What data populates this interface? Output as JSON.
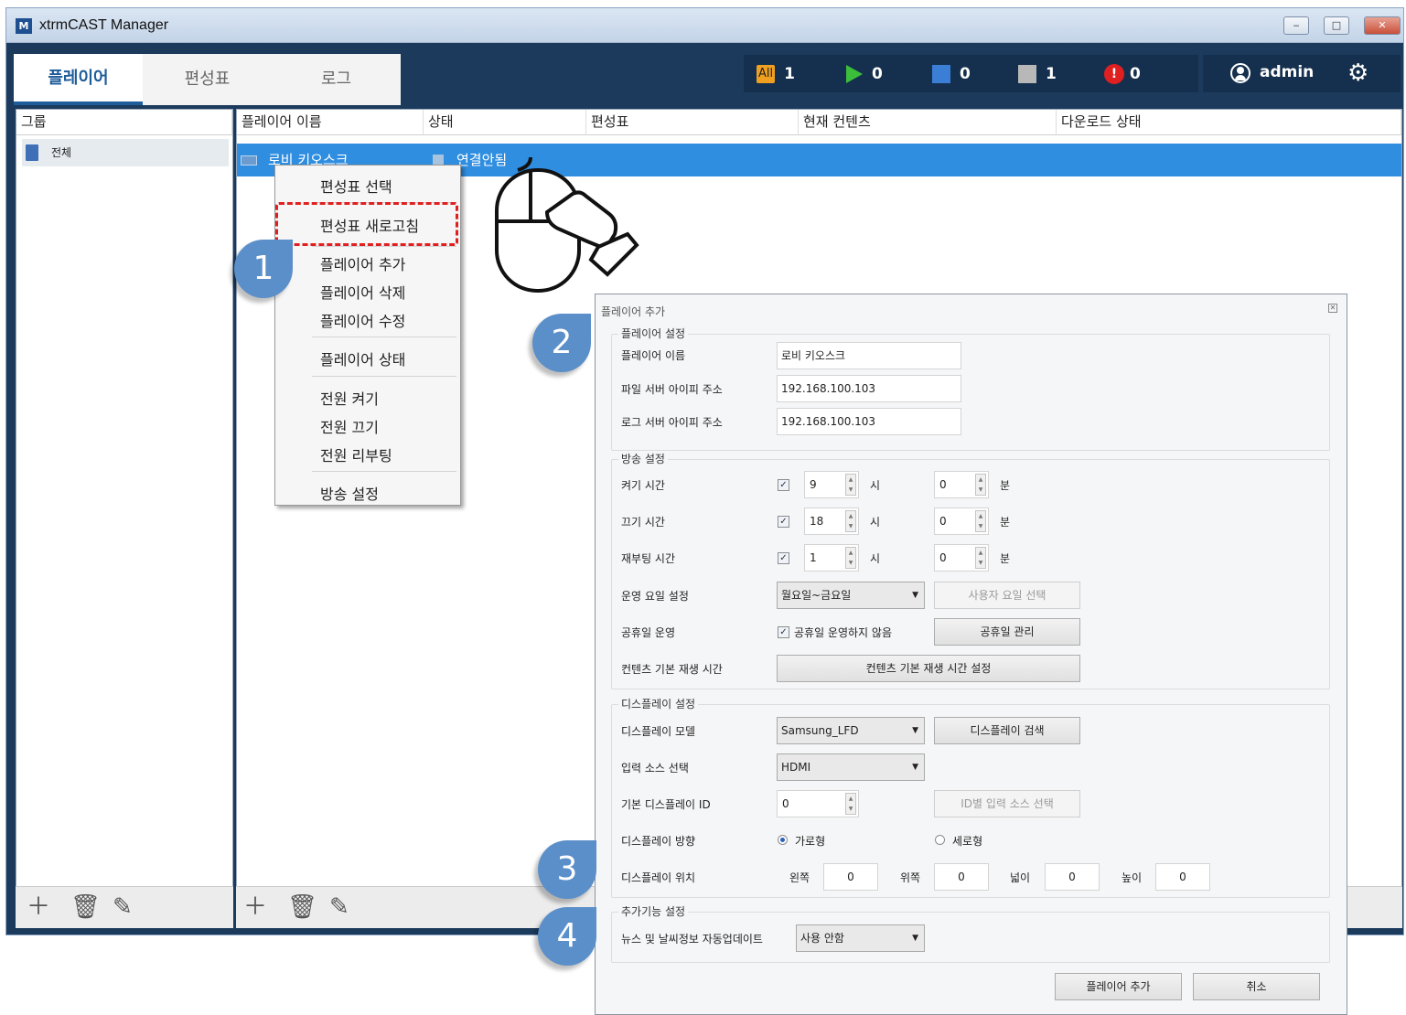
{
  "window": {
    "app_logo": "M",
    "title": "xtrmCAST Manager",
    "controls": {
      "minimize": "‒",
      "maximize": "□",
      "close": "✕"
    }
  },
  "tabs": [
    {
      "label": "플레이어",
      "active": true
    },
    {
      "label": "편성표",
      "active": false
    },
    {
      "label": "로그",
      "active": false
    }
  ],
  "status": {
    "all": {
      "icon_text": "All",
      "count": "1",
      "color": "#f0a020"
    },
    "playing": {
      "count": "0",
      "color": "#3bbf3b"
    },
    "stopped": {
      "count": "0",
      "color": "#3a7fd5"
    },
    "disconnected": {
      "count": "1",
      "color": "#b8b8b8"
    },
    "error": {
      "icon_text": "!",
      "count": "0",
      "color": "#e02020"
    }
  },
  "user": {
    "name": "admin",
    "icon": "user-icon",
    "settings_icon": "gear-icon"
  },
  "group_panel": {
    "header": "그룹",
    "items": [
      {
        "label": "전체",
        "icon": "document-icon"
      }
    ]
  },
  "player_table": {
    "columns": [
      "플레이어 이름",
      "상태",
      "편성표",
      "현재 컨텐츠",
      "다운로드 상태"
    ],
    "rows": [
      {
        "name": "로비 키오스크",
        "status": "연결안됨",
        "schedule": "",
        "content": "",
        "download": ""
      }
    ]
  },
  "context_menu": {
    "items": [
      "편성표 선택",
      "편성표 새로고침",
      "플레이어 추가",
      "플레이어 삭제",
      "플레이어 수정",
      "플레이어 상태",
      "전원 켜기",
      "전원 끄기",
      "전원 리부팅",
      "방송 설정"
    ]
  },
  "callouts": [
    "1",
    "2",
    "3",
    "4"
  ],
  "dialog": {
    "title": "플레이어 추가",
    "player_settings": {
      "legend": "플레이어 설정",
      "name_label": "플레이어 이름",
      "name_value": "로비 키오스크",
      "file_server_label": "파일 서버 아이피 주소",
      "file_server_value": "192.168.100.103",
      "log_server_label": "로그 서버 아이피 주소",
      "log_server_value": "192.168.100.103"
    },
    "broadcast_settings": {
      "legend": "방송 설정",
      "on_time_label": "켜기 시간",
      "on_hour": "9",
      "on_min": "0",
      "off_time_label": "끄기 시간",
      "off_hour": "18",
      "off_min": "0",
      "reboot_time_label": "재부팅 시간",
      "reboot_hour": "1",
      "reboot_min": "0",
      "hour_unit": "시",
      "min_unit": "분",
      "weekday_label": "운영 요일 설정",
      "weekday_value": "월요일~금요일",
      "custom_weekday_button": "사용자 요일 선택",
      "holiday_label": "공휴일 운영",
      "holiday_checkbox": "공휴일 운영하지 않음",
      "holiday_manage_button": "공휴일 관리",
      "content_time_label": "컨텐츠 기본 재생 시간",
      "content_time_button": "컨텐츠 기본 재생 시간 설정"
    },
    "display_settings": {
      "legend": "디스플레이 설정",
      "model_label": "디스플레이 모델",
      "model_value": "Samsung_LFD",
      "search_button": "디스플레이 검색",
      "input_label": "입력 소스 선택",
      "input_value": "HDMI",
      "id_label": "기본 디스플레이 ID",
      "id_value": "0",
      "id_source_button": "ID별 입력 소스 선택",
      "orientation_label": "디스플레이 방향",
      "landscape": "가로형",
      "portrait": "세로형",
      "position_label": "디스플레이 위치",
      "left_label": "왼쪽",
      "left_value": "0",
      "top_label": "위쪽",
      "top_value": "0",
      "width_label": "넓이",
      "width_value": "0",
      "height_label": "높이",
      "height_value": "0"
    },
    "extra_settings": {
      "legend": "추가기능 설정",
      "news_label": "뉴스 및 날씨정보 자동업데이트",
      "news_value": "사용 안함"
    },
    "add_button": "플레이어 추가",
    "cancel_button": "취소"
  }
}
